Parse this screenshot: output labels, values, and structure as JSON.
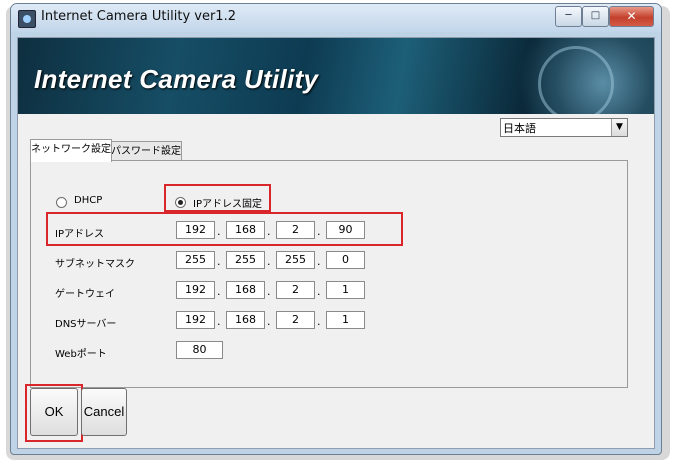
{
  "window": {
    "title": "Internet Camera Utility ver1.2",
    "minimize_glyph": "─",
    "maximize_glyph": "□",
    "close_glyph": "✕"
  },
  "banner": {
    "title": "Internet Camera Utility"
  },
  "language": {
    "selected": "日本語",
    "arrow": "▼"
  },
  "tabs": [
    {
      "label": "ネットワーク設定",
      "active": true
    },
    {
      "label": "パスワード設定",
      "active": false
    }
  ],
  "network": {
    "dhcp_label": "DHCP",
    "fixed_ip_label": "IPアドレス固定",
    "mode": "fixed",
    "ip_address_label": "IPアドレス",
    "ip_address": [
      "192",
      "168",
      "2",
      "90"
    ],
    "subnet_mask_label": "サブネットマスク",
    "subnet_mask": [
      "255",
      "255",
      "255",
      "0"
    ],
    "gateway_label": "ゲートウェイ",
    "gateway": [
      "192",
      "168",
      "2",
      "1"
    ],
    "dns_server_label": "DNSサーバー",
    "dns_server": [
      "192",
      "168",
      "2",
      "1"
    ],
    "web_port_label": "Webポート",
    "web_port": "80",
    "separator": "."
  },
  "buttons": {
    "ok": "OK",
    "cancel": "Cancel"
  },
  "colors": {
    "highlight": "#d8262b",
    "titlebar": "#c2d6ea"
  },
  "icons": {
    "app": "camera-icon",
    "dropdown": "chevron-down-icon"
  }
}
